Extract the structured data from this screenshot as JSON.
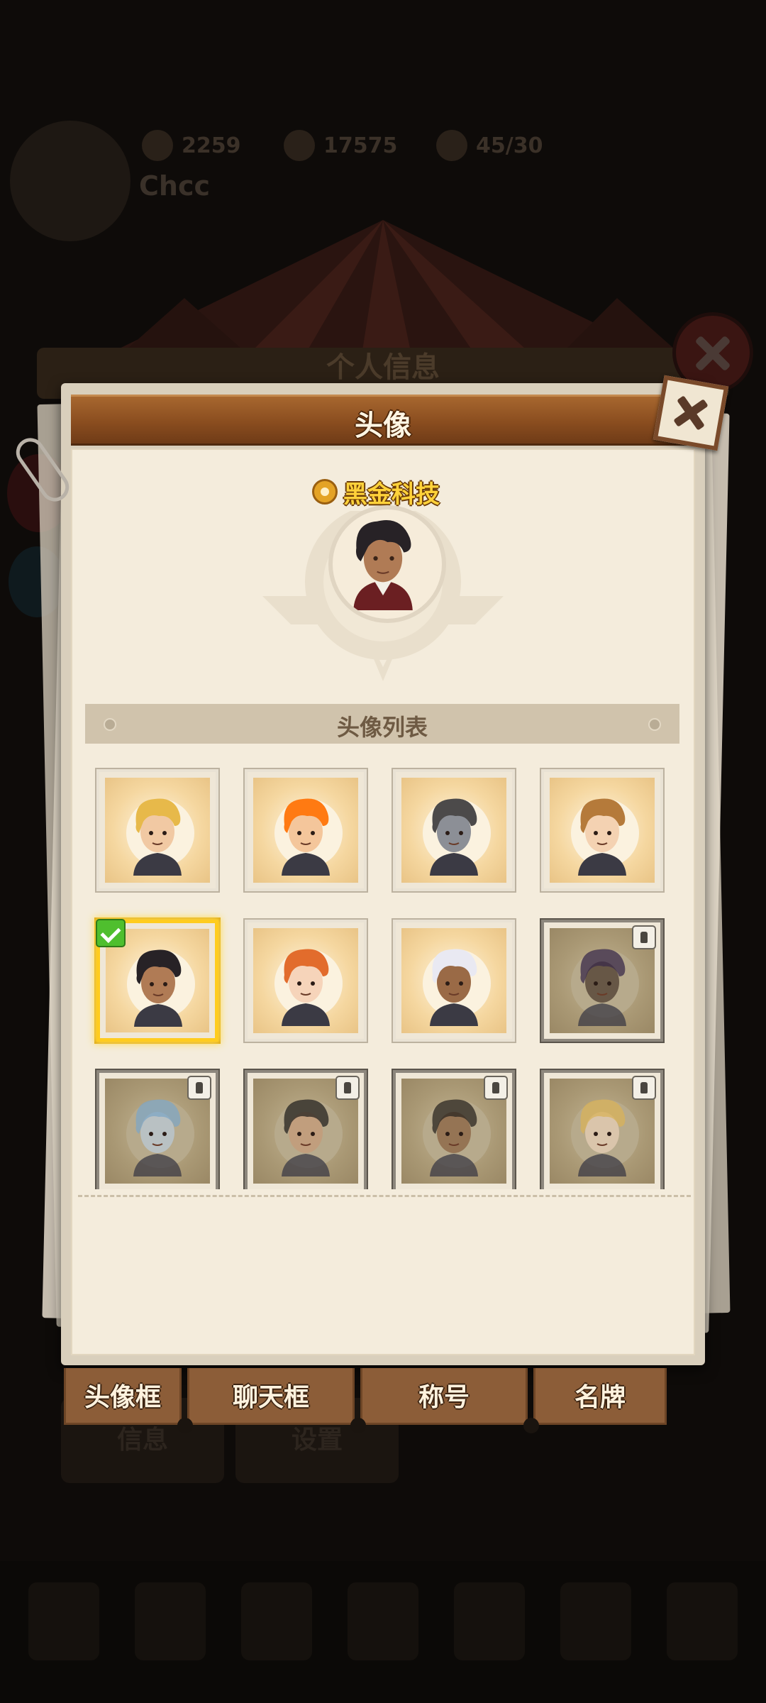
{
  "background": {
    "resources": [
      "2259",
      "17575",
      "45/30"
    ],
    "player_name": "Chcc",
    "header_title": "个人信息",
    "buttons": [
      "信息",
      "设置"
    ]
  },
  "popup": {
    "title": "头像",
    "current_avatar_name": "黑金科技",
    "list_title": "头像列表"
  },
  "avatars": [
    {
      "state": "unlocked",
      "hair": "#e7b94a",
      "skin": "#f1c9a3"
    },
    {
      "state": "unlocked",
      "hair": "#ff7a12",
      "skin": "#f4c69b"
    },
    {
      "state": "unlocked",
      "hair": "#4c4a4a",
      "skin": "#8c8f96"
    },
    {
      "state": "unlocked",
      "hair": "#b57a3a",
      "skin": "#f4d2b2"
    },
    {
      "state": "selected",
      "hair": "#272226",
      "skin": "#b07b55"
    },
    {
      "state": "unlocked",
      "hair": "#e26c2c",
      "skin": "#f6d4ba"
    },
    {
      "state": "unlocked",
      "hair": "#e9e9f2",
      "skin": "#9a6a46"
    },
    {
      "state": "locked",
      "hair": "#3a2a4a",
      "skin": "#4c3b2f"
    },
    {
      "state": "locked",
      "hair": "#7fa6c4",
      "skin": "#b9c8d6"
    },
    {
      "state": "locked",
      "hair": "#24221f",
      "skin": "#c49a78"
    },
    {
      "state": "locked",
      "hair": "#2b2520",
      "skin": "#8a6142"
    },
    {
      "state": "locked",
      "hair": "#d8b25a",
      "skin": "#e5cdb5"
    }
  ],
  "tabs": [
    "头像框",
    "聊天框",
    "称号",
    "名牌"
  ],
  "colors": {
    "title_bar": "#8a4d1f",
    "selected_border": "#ffcc1f",
    "check_badge": "#4fbf2e",
    "name_text": "#ffd23a"
  }
}
